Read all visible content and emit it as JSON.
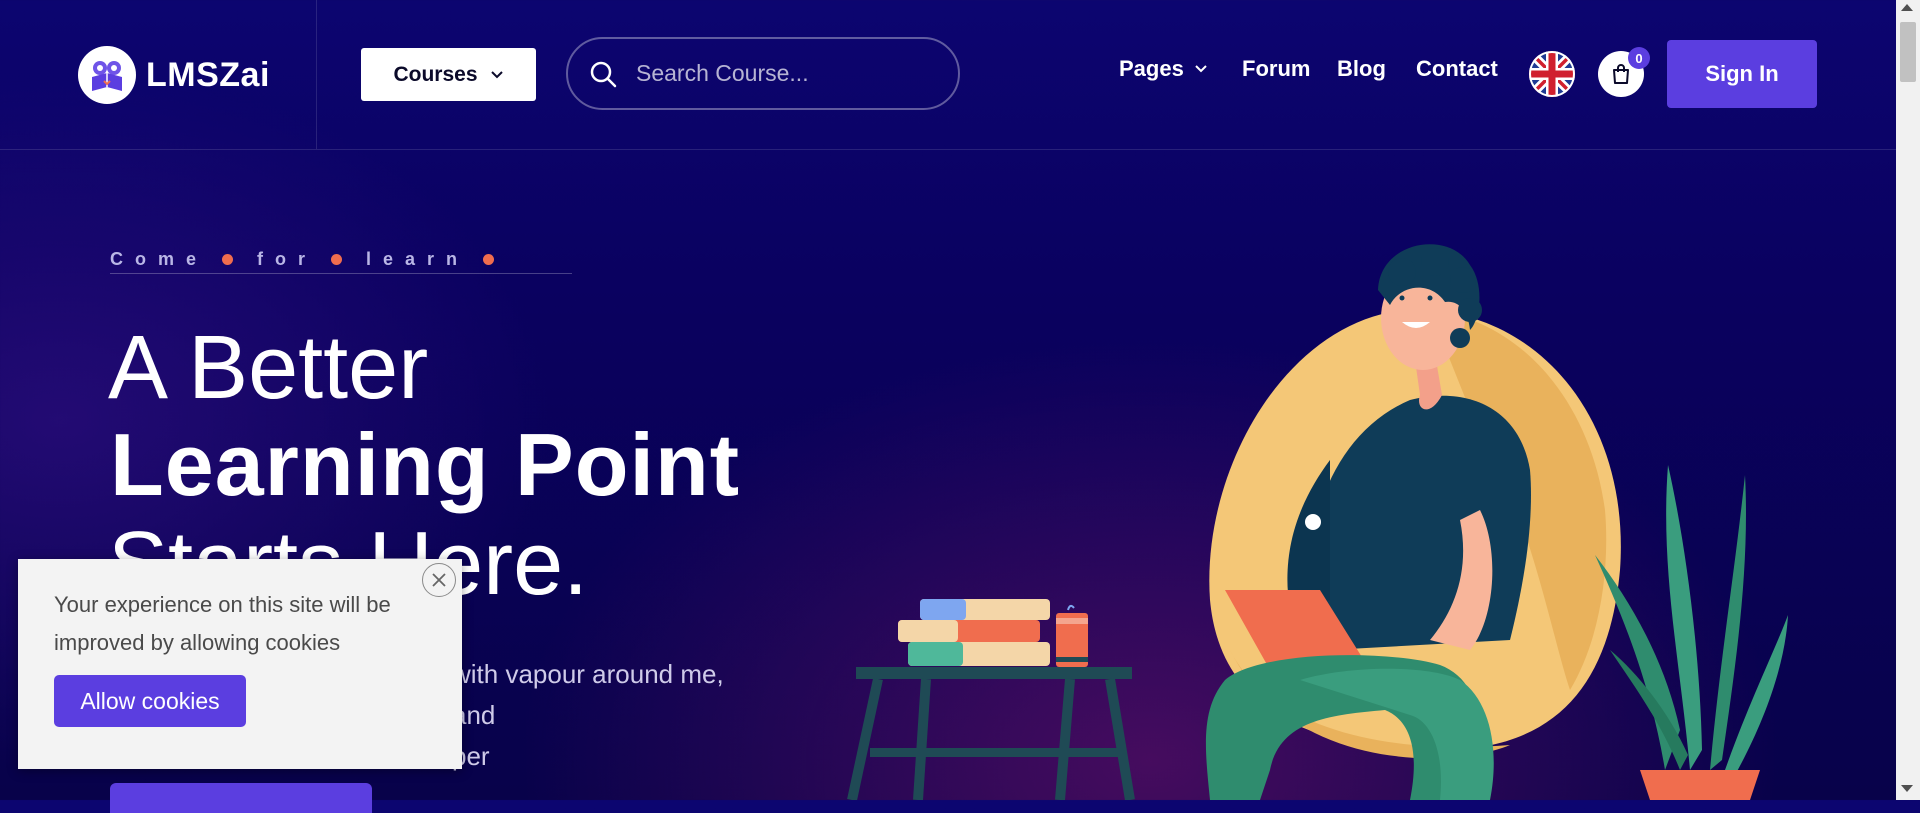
{
  "header": {
    "brand_name": "LMSZai",
    "courses_label": "Courses",
    "search_placeholder": "Search Course...",
    "nav": [
      {
        "label": "Pages",
        "has_dropdown": true
      },
      {
        "label": "Forum"
      },
      {
        "label": "Blog"
      },
      {
        "label": "Contact"
      }
    ],
    "language_flag": "uk-flag-icon",
    "cart_count": "0",
    "signin_label": "Sign In"
  },
  "hero": {
    "eyebrow_words": [
      "Come",
      "for",
      "learn"
    ],
    "headline_line1": "A Better",
    "headline_line2": "Learning Point",
    "headline_line3": "Starts Here.",
    "description_line1": "with vapour around me, and",
    "description_line2": "per"
  },
  "cookie_banner": {
    "text": "Your experience on this site will be improved by allowing cookies",
    "button_label": "Allow cookies"
  },
  "colors": {
    "accent": "#5b3ee0",
    "dot": "#f06d4e",
    "background": "#0a0160"
  }
}
